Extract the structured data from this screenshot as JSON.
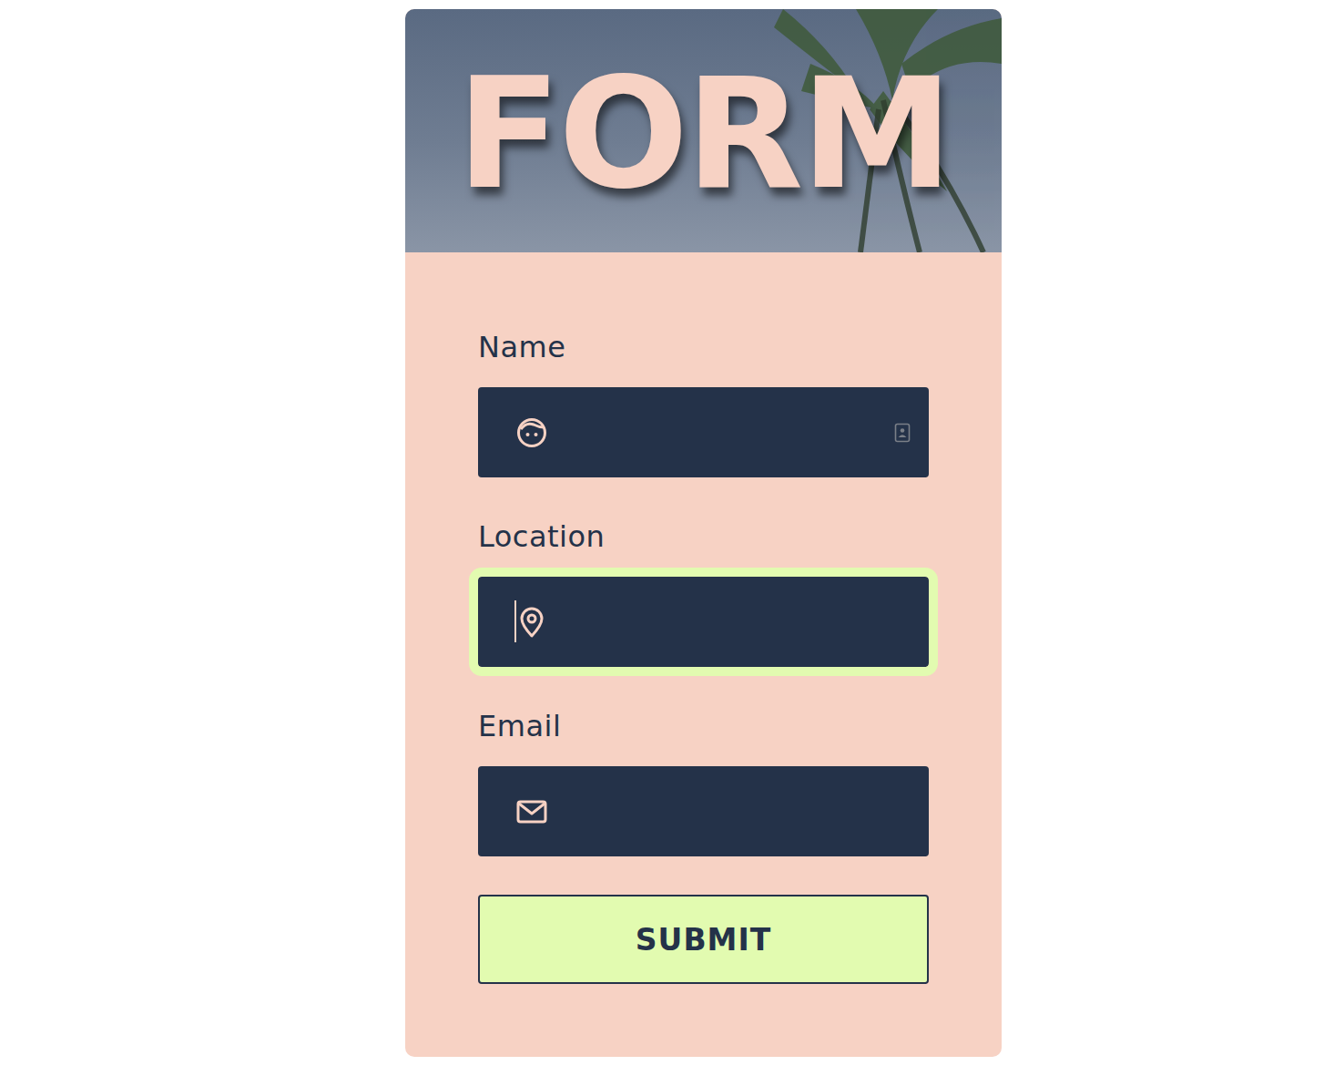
{
  "header": {
    "title": "FORM"
  },
  "fields": [
    {
      "label": "Name",
      "value": "",
      "focused": false,
      "kind": "name"
    },
    {
      "label": "Location",
      "value": "",
      "focused": true,
      "kind": "location"
    },
    {
      "label": "Email",
      "value": "",
      "focused": false,
      "kind": "email"
    }
  ],
  "submit": {
    "label": "SUBMIT"
  }
}
